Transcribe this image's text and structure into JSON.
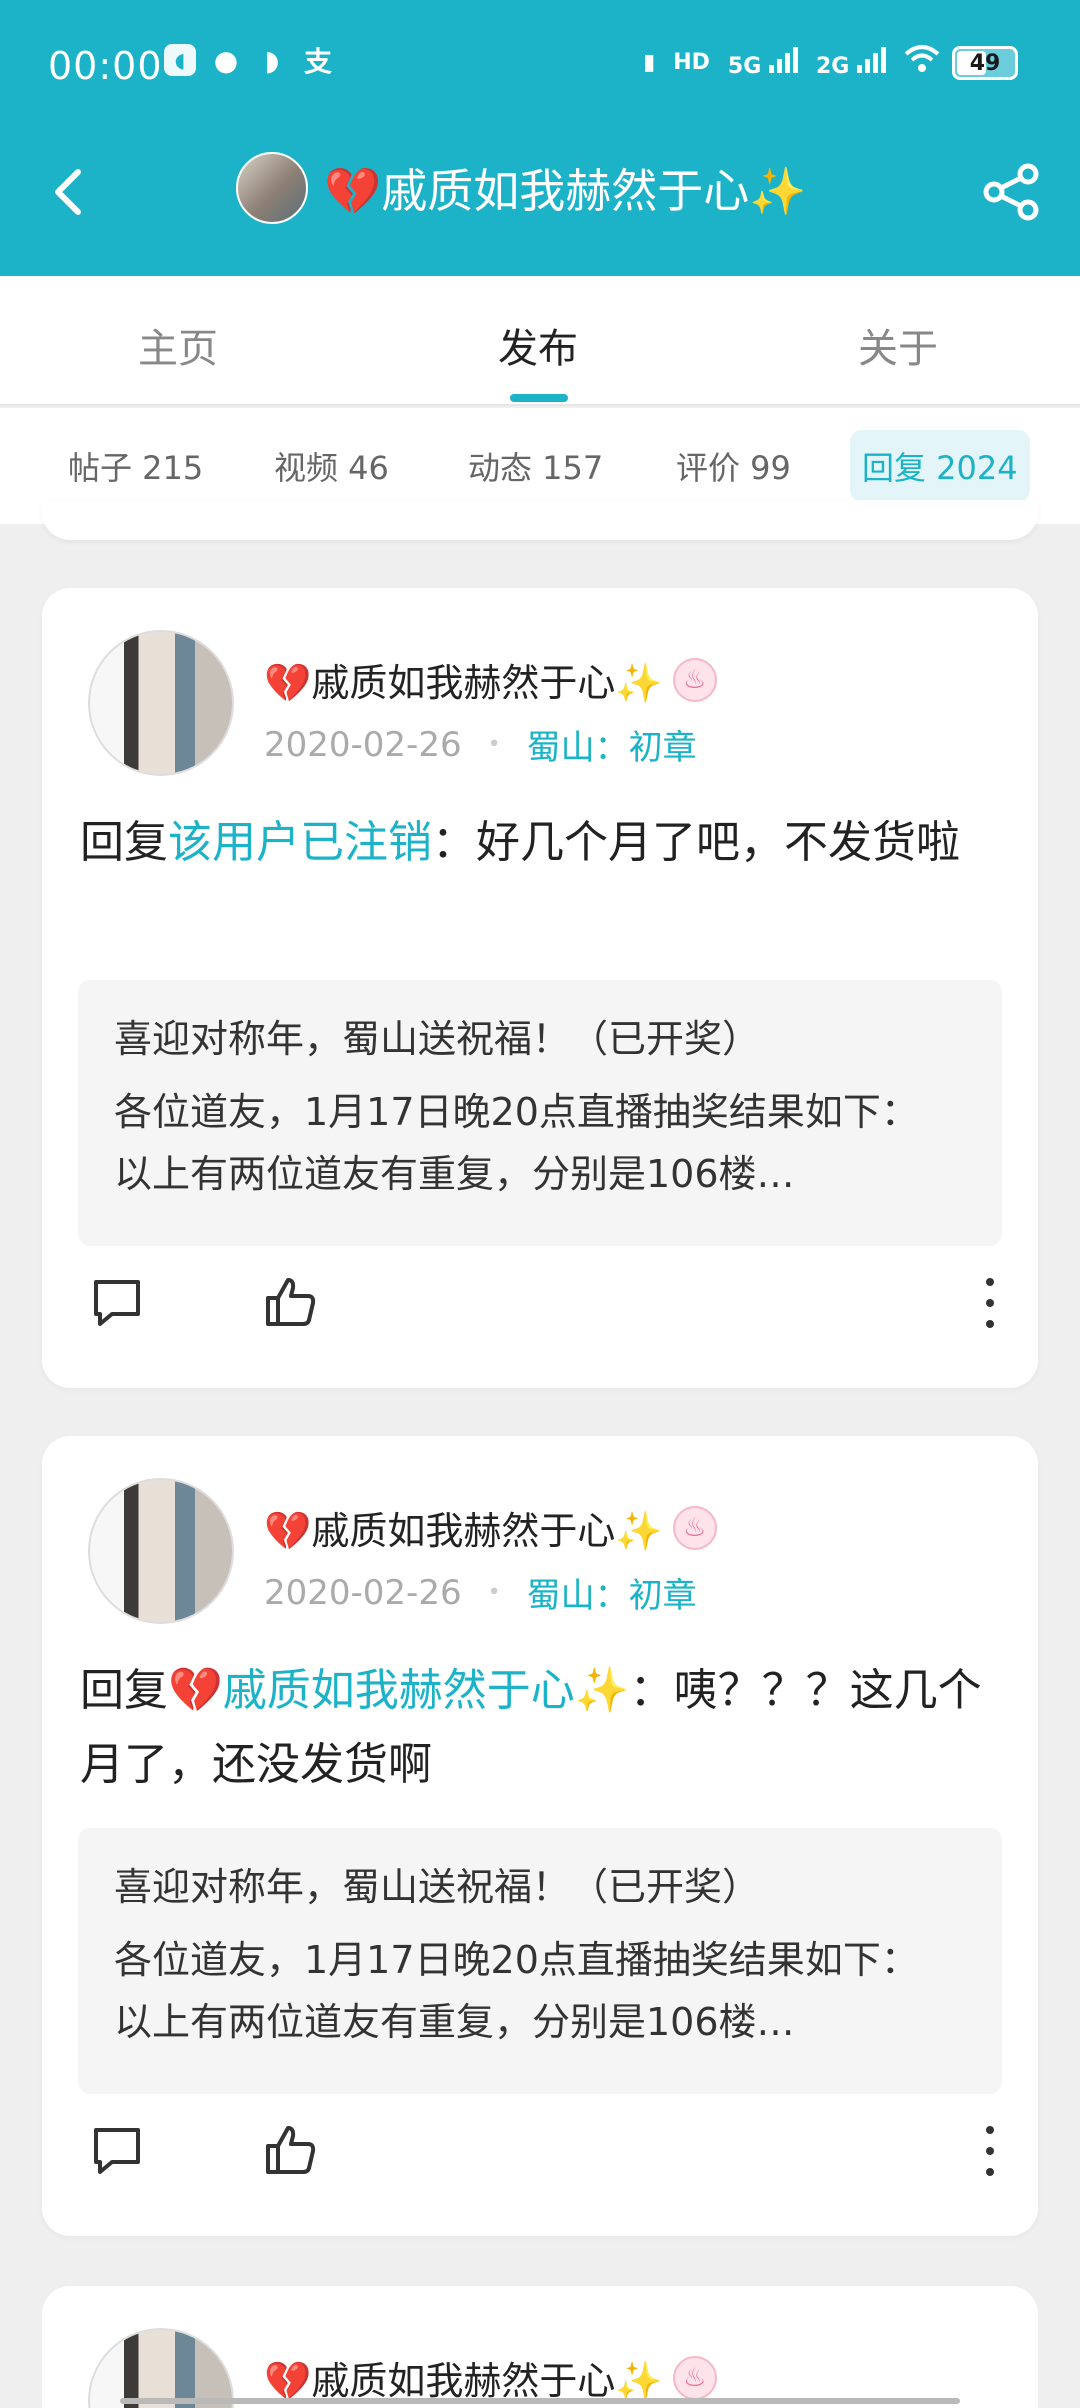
{
  "status_bar": {
    "time": "00:00",
    "app_icons": [
      "alipay-like-icon",
      "wechat-icon",
      "message-icon",
      "alipay-icon"
    ],
    "network": [
      "HD",
      "5G",
      "2G"
    ],
    "battery": "49"
  },
  "header": {
    "title": "💔戚质如我赫然于心✨",
    "accent_color": "#1cb3c8"
  },
  "tabs": [
    {
      "label": "主页"
    },
    {
      "label": "发布",
      "active": true
    },
    {
      "label": "关于"
    }
  ],
  "subtabs": [
    {
      "label": "帖子 215"
    },
    {
      "label": "视频 46"
    },
    {
      "label": "动态 157"
    },
    {
      "label": "评价 99"
    },
    {
      "label": "回复 2024",
      "active": true
    }
  ],
  "posts": [
    {
      "author": "💔戚质如我赫然于心✨",
      "date": "2020-02-26",
      "section": "蜀山：初章",
      "reply_prefix": "回复",
      "reply_to": "该用户已注销",
      "reply_text": "：好几个月了吧，不发货啦",
      "quote_title": "喜迎对称年，蜀山送祝福！（已开奖）",
      "quote_body": "各位道友，1月17日晚20点直播抽奖结果如下： 以上有两位道友有重复，分别是106楼…"
    },
    {
      "author": "💔戚质如我赫然于心✨",
      "date": "2020-02-26",
      "section": "蜀山：初章",
      "reply_prefix": "回复",
      "reply_to": "💔戚质如我赫然于心✨",
      "reply_text": "：咦？？？这几个月了，还没发货啊",
      "quote_title": "喜迎对称年，蜀山送祝福！（已开奖）",
      "quote_body": "各位道友，1月17日晚20点直播抽奖结果如下： 以上有两位道友有重复，分别是106楼…"
    },
    {
      "author": "💔戚质如我赫然于心✨"
    }
  ]
}
